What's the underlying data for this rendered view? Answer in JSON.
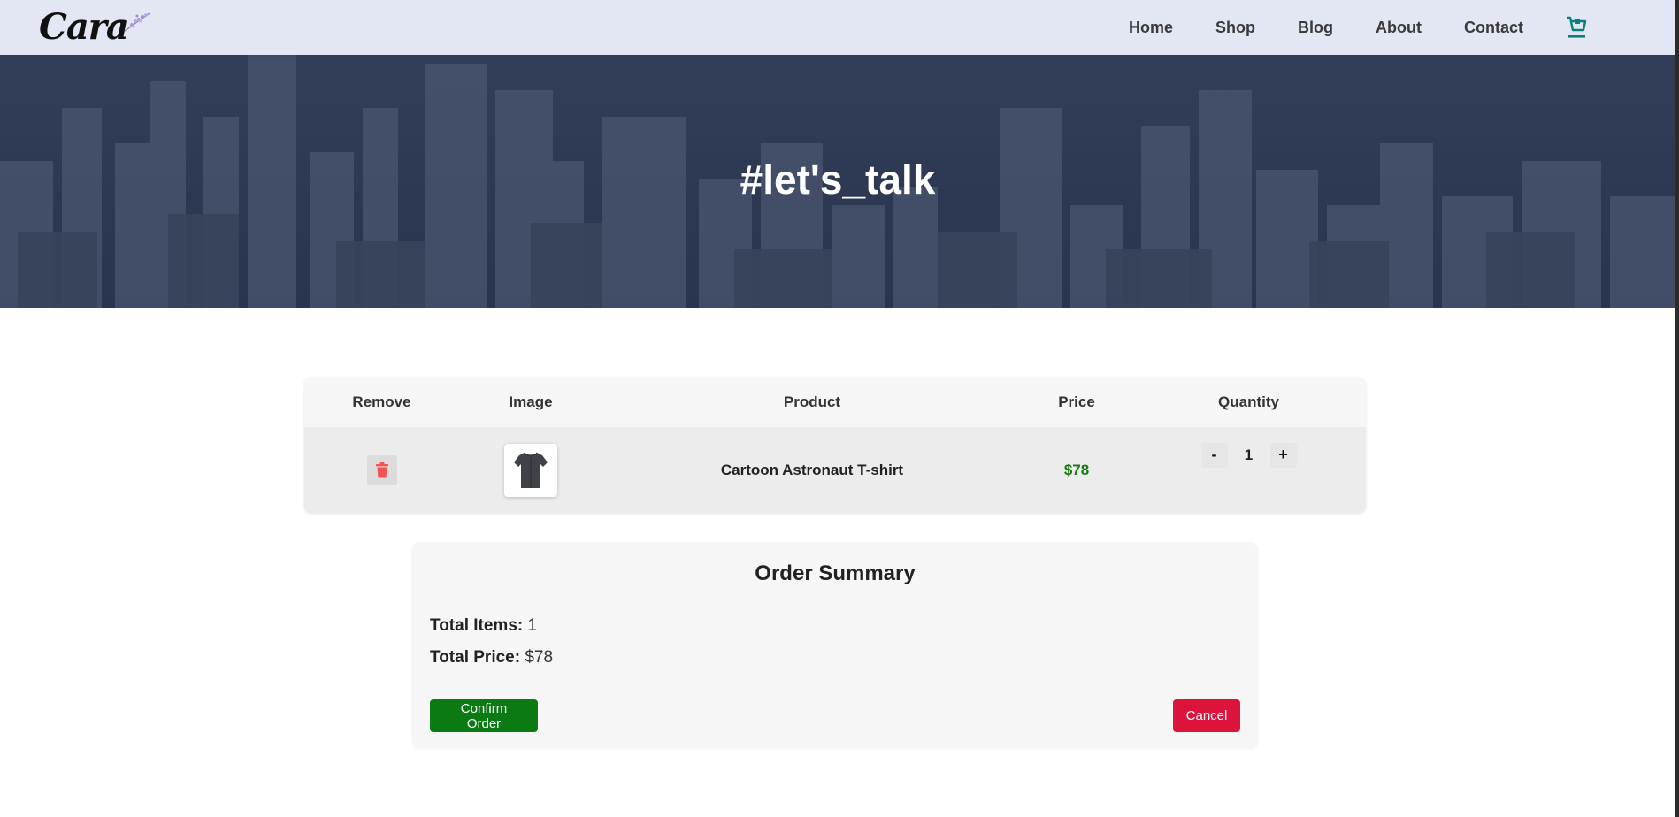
{
  "brand": {
    "logo_text": "Cara"
  },
  "nav": {
    "items": [
      {
        "label": "Home"
      },
      {
        "label": "Shop"
      },
      {
        "label": "Blog"
      },
      {
        "label": "About"
      },
      {
        "label": "Contact"
      }
    ],
    "cart_icon": "cart-icon"
  },
  "hero": {
    "title": "#let's_talk"
  },
  "cart": {
    "headers": {
      "remove": "Remove",
      "image": "Image",
      "product": "Product",
      "price": "Price",
      "quantity": "Quantity"
    },
    "rows": [
      {
        "remove_icon": "trash-icon",
        "image_icon": "tshirt-icon",
        "product": "Cartoon Astronaut T-shirt",
        "price": "$78",
        "quantity": "1",
        "decrement": "-",
        "increment": "+"
      }
    ]
  },
  "summary": {
    "title": "Order Summary",
    "total_items_label": "Total Items:",
    "total_items_value": "1",
    "total_price_label": "Total Price:",
    "total_price_value": "$78",
    "confirm_label": "Confirm Order",
    "cancel_label": "Cancel"
  },
  "colors": {
    "nav_bg": "#e3e6f3",
    "accent_teal": "#088178",
    "price_green": "#1c7a12",
    "confirm_green": "#0b7a12",
    "cancel_red": "#dc143c",
    "trash_red": "#f05454"
  }
}
